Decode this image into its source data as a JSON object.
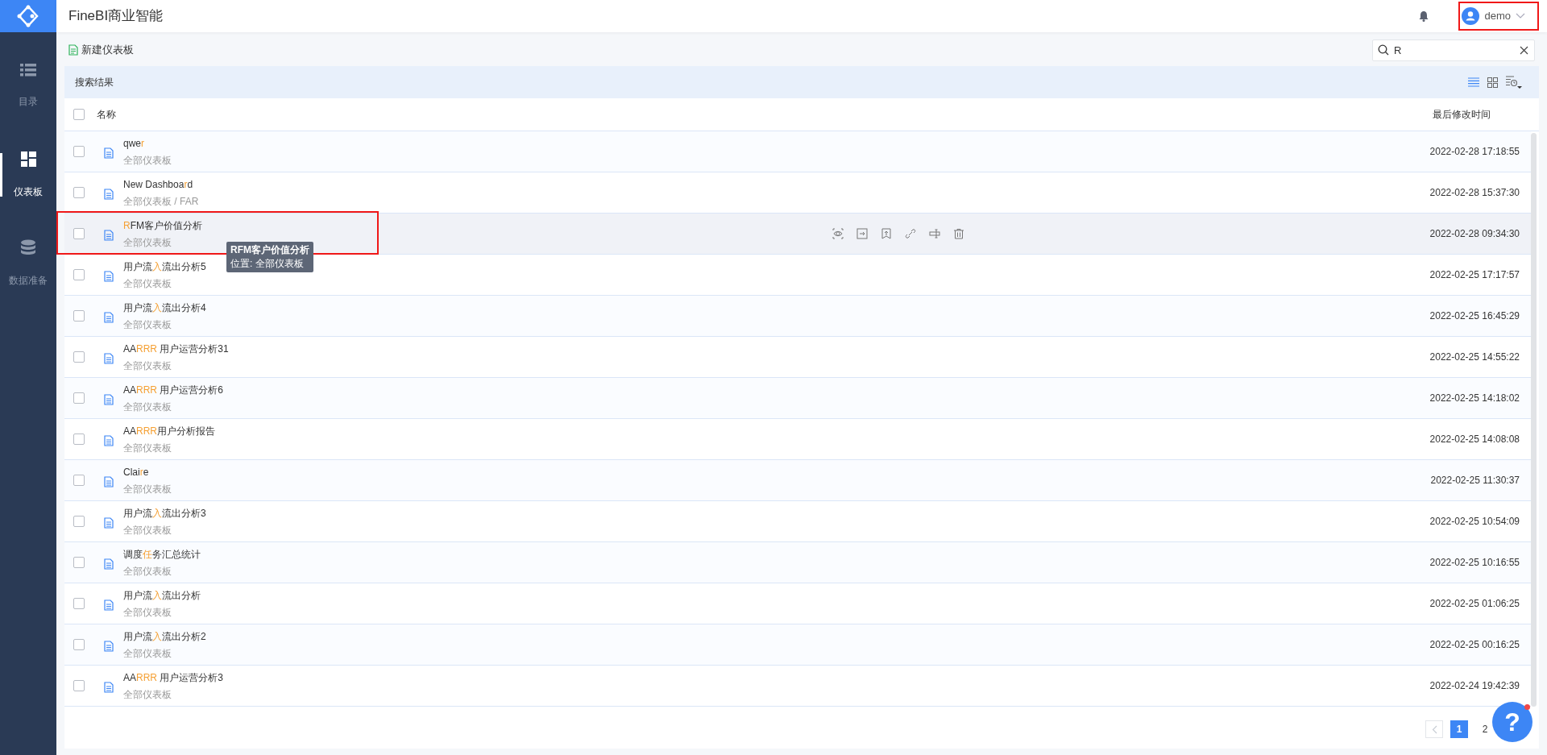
{
  "app_title": "FineBI商业智能",
  "sidebar": {
    "items": [
      {
        "label": "目录",
        "kind": "list",
        "selected": false
      },
      {
        "label": "仪表板",
        "kind": "grid",
        "selected": true
      },
      {
        "label": "数据准备",
        "kind": "database",
        "selected": false
      }
    ]
  },
  "user": {
    "name": "demo",
    "highlighted": true
  },
  "toolbar": {
    "new_button": "新建仪表板",
    "search": {
      "value": "R"
    }
  },
  "panel": {
    "title": "搜索结果",
    "views": [
      {
        "kind": "list",
        "selected": true
      },
      {
        "kind": "grid",
        "selected": false
      }
    ]
  },
  "table": {
    "columns": [
      "名称",
      "最后修改时间"
    ],
    "select_all": {
      "checked": false
    },
    "rows": [
      {
        "name": [
          {
            "text": "qwe",
            "match": false
          },
          {
            "text": "r",
            "match": true
          }
        ],
        "path": "全部仪表板",
        "modified": "2022-02-28 17:18:55",
        "hovered": false,
        "highlighted": false,
        "checked": false
      },
      {
        "name": [
          {
            "text": "New Dashboa",
            "match": false
          },
          {
            "text": "r",
            "match": true
          },
          {
            "text": "d",
            "match": false
          }
        ],
        "path": "全部仪表板 / FAR",
        "modified": "2022-02-28 15:37:30",
        "hovered": false,
        "highlighted": false,
        "checked": false
      },
      {
        "name": [
          {
            "text": "R",
            "match": true
          },
          {
            "text": "FM客户价值分析",
            "match": false
          }
        ],
        "path": "全部仪表板",
        "modified": "2022-02-28 09:34:30",
        "hovered": true,
        "highlighted": true,
        "checked": false
      },
      {
        "name": [
          {
            "text": "用户流",
            "match": false
          },
          {
            "text": "入",
            "match": true
          },
          {
            "text": "流出分析5",
            "match": false
          }
        ],
        "path": "全部仪表板",
        "modified": "2022-02-25 17:17:57",
        "hovered": false,
        "highlighted": false,
        "checked": false
      },
      {
        "name": [
          {
            "text": "用户流",
            "match": false
          },
          {
            "text": "入",
            "match": true
          },
          {
            "text": "流出分析4",
            "match": false
          }
        ],
        "path": "全部仪表板",
        "modified": "2022-02-25 16:45:29",
        "hovered": false,
        "highlighted": false,
        "checked": false
      },
      {
        "name": [
          {
            "text": "AA",
            "match": false
          },
          {
            "text": "RRR",
            "match": true
          },
          {
            "text": " 用户运营分析31",
            "match": false
          }
        ],
        "path": "全部仪表板",
        "modified": "2022-02-25 14:55:22",
        "hovered": false,
        "highlighted": false,
        "checked": false
      },
      {
        "name": [
          {
            "text": "AA",
            "match": false
          },
          {
            "text": "RRR",
            "match": true
          },
          {
            "text": " 用户运营分析6",
            "match": false
          }
        ],
        "path": "全部仪表板",
        "modified": "2022-02-25 14:18:02",
        "hovered": false,
        "highlighted": false,
        "checked": false
      },
      {
        "name": [
          {
            "text": "AA",
            "match": false
          },
          {
            "text": "RRR",
            "match": true
          },
          {
            "text": "用户分析报告",
            "match": false
          }
        ],
        "path": "全部仪表板",
        "modified": "2022-02-25 14:08:08",
        "hovered": false,
        "highlighted": false,
        "checked": false
      },
      {
        "name": [
          {
            "text": "Clai",
            "match": false
          },
          {
            "text": "r",
            "match": true
          },
          {
            "text": "e",
            "match": false
          }
        ],
        "path": "全部仪表板",
        "modified": "2022-02-25 11:30:37",
        "hovered": false,
        "highlighted": false,
        "checked": false
      },
      {
        "name": [
          {
            "text": "用户流",
            "match": false
          },
          {
            "text": "入",
            "match": true
          },
          {
            "text": "流出分析3",
            "match": false
          }
        ],
        "path": "全部仪表板",
        "modified": "2022-02-25 10:54:09",
        "hovered": false,
        "highlighted": false,
        "checked": false
      },
      {
        "name": [
          {
            "text": "调度",
            "match": false
          },
          {
            "text": "任",
            "match": true
          },
          {
            "text": "务汇总统计",
            "match": false
          }
        ],
        "path": "全部仪表板",
        "modified": "2022-02-25 10:16:55",
        "hovered": false,
        "highlighted": false,
        "checked": false
      },
      {
        "name": [
          {
            "text": "用户流",
            "match": false
          },
          {
            "text": "入",
            "match": true
          },
          {
            "text": "流出分析",
            "match": false
          }
        ],
        "path": "全部仪表板",
        "modified": "2022-02-25 01:06:25",
        "hovered": false,
        "highlighted": false,
        "checked": false
      },
      {
        "name": [
          {
            "text": "用户流",
            "match": false
          },
          {
            "text": "入",
            "match": true
          },
          {
            "text": "流出分析2",
            "match": false
          }
        ],
        "path": "全部仪表板",
        "modified": "2022-02-25 00:16:25",
        "hovered": false,
        "highlighted": false,
        "checked": false
      },
      {
        "name": [
          {
            "text": "AA",
            "match": false
          },
          {
            "text": "RRR",
            "match": true
          },
          {
            "text": " 用户运营分析3",
            "match": false
          }
        ],
        "path": "全部仪表板",
        "modified": "2022-02-24 19:42:39",
        "hovered": false,
        "highlighted": false,
        "checked": false
      }
    ]
  },
  "tooltip": {
    "title": "RFM客户价值分析",
    "location": "位置: 全部仪表板"
  },
  "pagination": {
    "pages": [
      {
        "label": "1",
        "selected": true
      },
      {
        "label": "2",
        "selected": false
      }
    ]
  },
  "help_button": {
    "label": "?",
    "notification": true
  }
}
